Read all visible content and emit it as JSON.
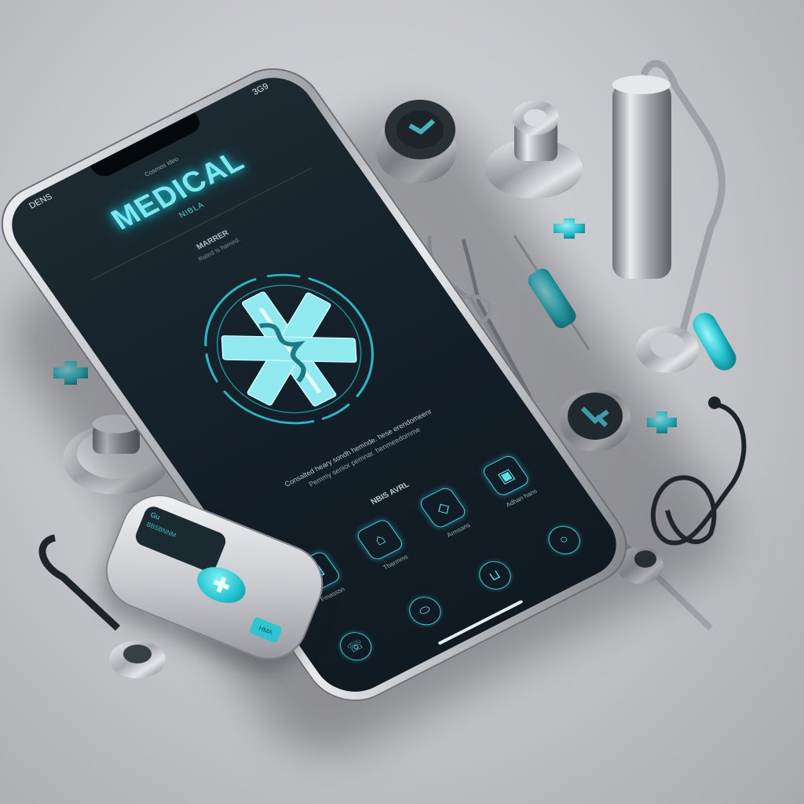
{
  "phone": {
    "status_left": "DENS",
    "status_right": "3G9",
    "status_center": "Cosmos ideo",
    "app_title": "MEDICAL",
    "app_subtitle": "NIBLA",
    "section_title": "MARRER",
    "section_subtitle": "Rated is hamed.",
    "description_line1": "Consalted heary sondh hemnde. hese erendomeenr",
    "description_line2": "Pemmy senior pemnar. henmeedomme",
    "features_title": "NBIS AVRL",
    "features": [
      {
        "icon": "lock-icon",
        "glyph": "⊡",
        "label": "Fmasssn"
      },
      {
        "icon": "tag-icon",
        "glyph": "⌂",
        "label": "Tbarmms"
      },
      {
        "icon": "medicine-icon",
        "glyph": "◇",
        "label": "Armsans"
      },
      {
        "icon": "box-icon",
        "glyph": "▣",
        "label": "Adhan hans"
      }
    ],
    "tabs": [
      {
        "icon": "phone-icon",
        "glyph": "☏"
      },
      {
        "icon": "pill-icon",
        "glyph": "⬭"
      },
      {
        "icon": "cup-icon",
        "glyph": "⊔"
      },
      {
        "icon": "circle-icon",
        "glyph": "○"
      }
    ]
  },
  "remote": {
    "display_line1": "Gu",
    "display_line2": "BBSBNNM",
    "button_glyph": "✚",
    "tag": "HMA"
  },
  "colors": {
    "accent": "#3bd3de",
    "screen_bg": "#14202a",
    "metal_light": "#f2f3f5",
    "metal_dark": "#7d8086",
    "background": "#c4c5c8"
  }
}
